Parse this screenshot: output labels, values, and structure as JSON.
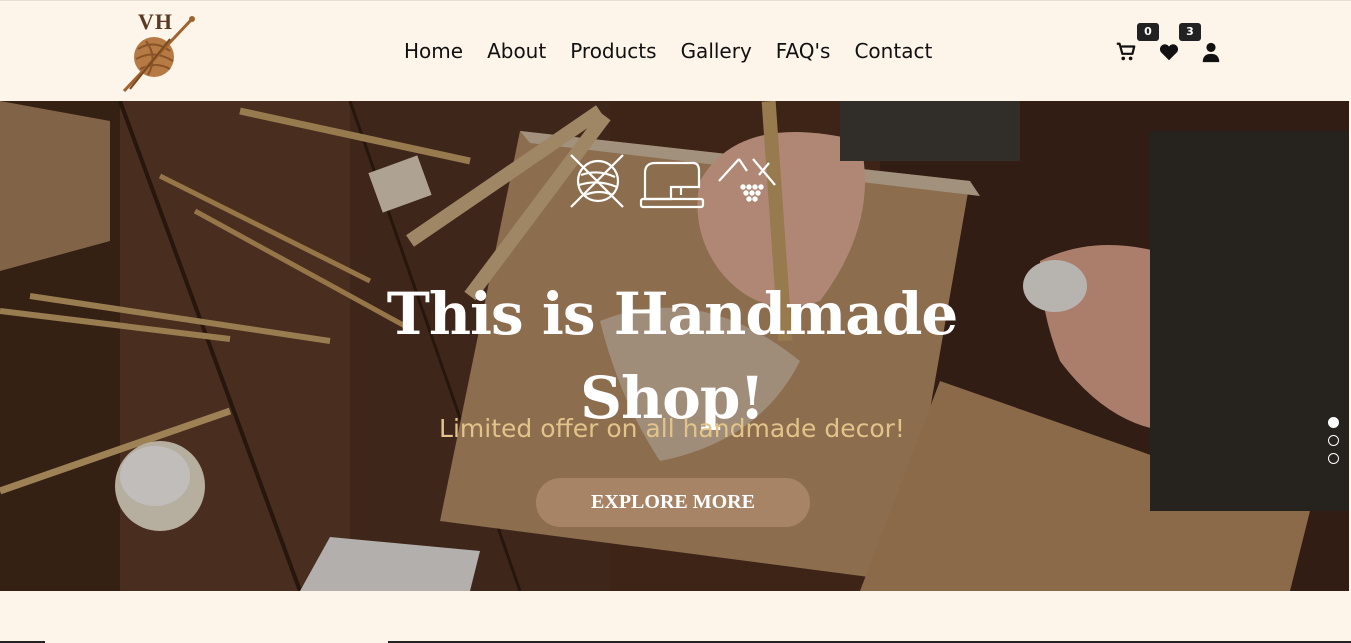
{
  "brand": {
    "logo_text": "VH"
  },
  "nav": {
    "items": [
      {
        "label": "Home"
      },
      {
        "label": "About"
      },
      {
        "label": "Products"
      },
      {
        "label": "Gallery"
      },
      {
        "label": "FAQ's"
      },
      {
        "label": "Contact"
      }
    ]
  },
  "header_icons": {
    "cart_icon": "cart-icon",
    "cart_count": "0",
    "wishlist_icon": "heart-icon",
    "wishlist_count": "3",
    "account_icon": "user-icon"
  },
  "hero": {
    "title": "This is Handmade Shop!",
    "subtitle": "Limited offer on all handmade decor!",
    "cta_label": "EXPLORE MORE",
    "icons": [
      "yarn-ball-icon",
      "sewing-machine-icon",
      "knitting-icon"
    ],
    "slides_total": 3,
    "active_slide": 1
  },
  "colors": {
    "background": "#fdf4ea",
    "accent": "#a88466",
    "subtitle": "#e2c48a",
    "text": "#111111"
  }
}
